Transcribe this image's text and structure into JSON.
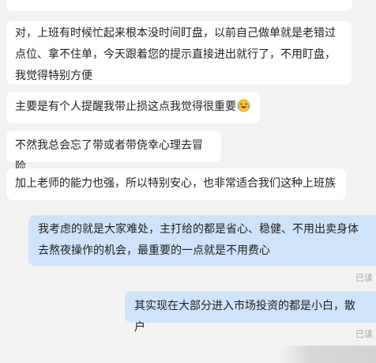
{
  "messages": [
    {
      "direction": "incoming",
      "text": "对，上班有时候忙起来根本没时间盯盘，以前自己做单就是老错过点位、拿不住单，今天跟着您的提示直接进出就行了，不用盯盘，我觉得特别方便"
    },
    {
      "direction": "incoming",
      "text": "主要是有个人提醒我带止损这点我觉得很重要",
      "emoji": "crying-laughing-emoji"
    },
    {
      "direction": "incoming",
      "text": "不然我总会忘了带或者带侥幸心理去冒险"
    },
    {
      "direction": "incoming",
      "text": "加上老师的能力也强，所以特别安心，也非常适合我们这种上班族"
    },
    {
      "direction": "outgoing",
      "text": "我考虑的就是大家难处，主打给的都是省心、稳健、不用出卖身体去熬夜操作的机会，最重要的一点就是不用费心",
      "status": "已读"
    },
    {
      "direction": "outgoing",
      "text": "其实现在大部分进入市场投资的都是小白，散户",
      "status": "已读"
    }
  ],
  "colors": {
    "background": "#f2f2f2",
    "incoming_bubble": "#ffffff",
    "outgoing_bubble": "#cfe3fb",
    "text": "#1f1f1f",
    "status_text": "#a3a3a3"
  }
}
